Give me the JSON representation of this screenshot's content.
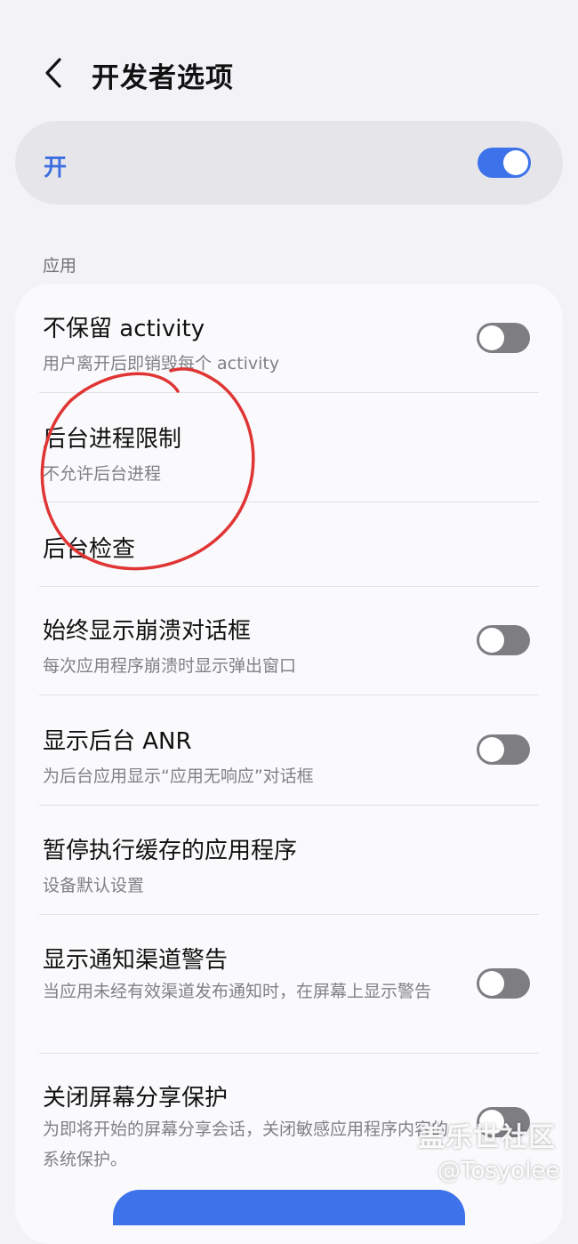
{
  "header": {
    "title": "开发者选项"
  },
  "master_switch": {
    "label": "开",
    "state": "on"
  },
  "section": {
    "label": "应用"
  },
  "settings": [
    {
      "title": "不保留 activity",
      "subtitle": "用户离开后即销毁每个 activity",
      "toggle": "off"
    },
    {
      "title": "后台进程限制",
      "subtitle": "不允许后台进程"
    },
    {
      "title": "后台检查"
    },
    {
      "title": "始终显示崩溃对话框",
      "subtitle": "每次应用程序崩溃时显示弹出窗口",
      "toggle": "off"
    },
    {
      "title": "显示后台 ANR",
      "subtitle": "为后台应用显示“应用无响应”对话框",
      "toggle": "off"
    },
    {
      "title": "暂停执行缓存的应用程序",
      "subtitle": "设备默认设置"
    },
    {
      "title": "显示通知渠道警告",
      "subtitle": "当应用未经有效渠道发布通知时，在屏幕上显示警告",
      "toggle": "off"
    },
    {
      "title": "关闭屏幕分享保护",
      "subtitle": "为即将开始的屏幕分享会话，关闭敏感应用程序内容的系统保护。",
      "toggle": "off"
    }
  ],
  "watermark": {
    "line1": "盖乐世社区",
    "line2": "@Tosyolee"
  },
  "colors": {
    "accent": "#3e72ea",
    "annotation": "#e03535"
  }
}
